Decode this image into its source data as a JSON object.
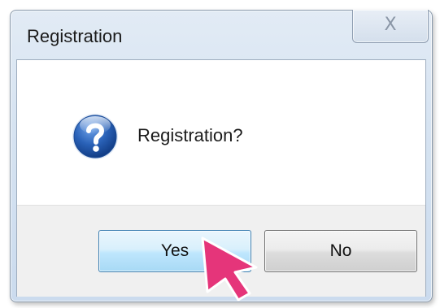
{
  "window": {
    "title": "Registration",
    "close_glyph": "X"
  },
  "message": {
    "icon": "question-icon",
    "text": "Registration?"
  },
  "buttons": {
    "yes_label": "Yes",
    "no_label": "No"
  },
  "pointer": {
    "icon": "pointer-arrow-icon",
    "color": "#e5357a"
  },
  "colors": {
    "icon_blue": "#2a62b8",
    "title_gradient_top": "#e2ebf5",
    "title_gradient_bottom": "#cbdbee",
    "button_panel": "#f0f0f0",
    "default_button_border": "#3c7fb1"
  }
}
